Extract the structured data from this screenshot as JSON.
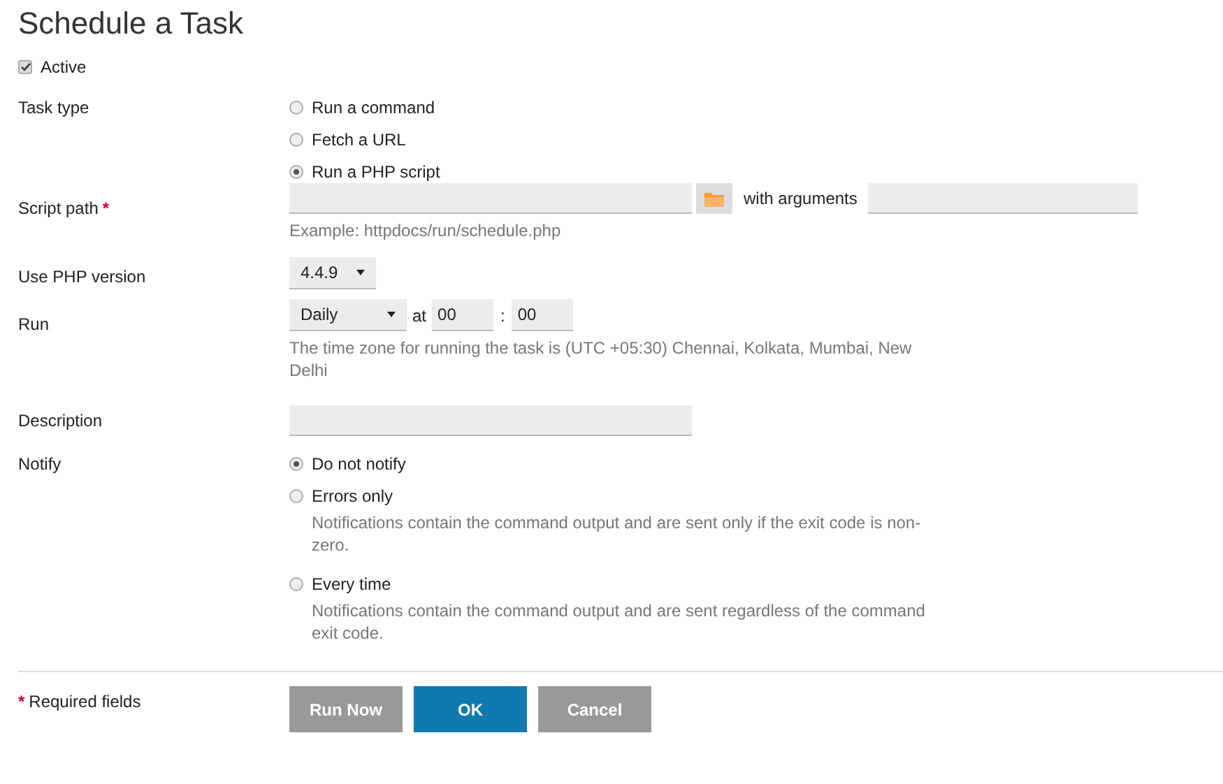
{
  "title": "Schedule a Task",
  "active": {
    "label": "Active",
    "checked": true
  },
  "task_type": {
    "label": "Task type",
    "options": [
      {
        "label": "Run a command",
        "selected": false
      },
      {
        "label": "Fetch a URL",
        "selected": false
      },
      {
        "label": "Run a PHP script",
        "selected": true
      }
    ]
  },
  "script_path": {
    "label": "Script path",
    "required_mark": "*",
    "arguments_label": "with arguments",
    "hint": "Example: httpdocs/run/schedule.php"
  },
  "php_version": {
    "label": "Use PHP version",
    "value": "4.4.9"
  },
  "run": {
    "label": "Run",
    "frequency": "Daily",
    "at_label": "at",
    "hour": "00",
    "separator": ":",
    "minute": "00",
    "hint": "The time zone for running the task is (UTC +05:30) Chennai, Kolkata, Mumbai, New Delhi"
  },
  "description": {
    "label": "Description"
  },
  "notify": {
    "label": "Notify",
    "options": [
      {
        "label": "Do not notify",
        "selected": true
      },
      {
        "label": "Errors only",
        "selected": false,
        "note": "Notifications contain the command output and are sent only if the exit code is non-zero."
      },
      {
        "label": "Every time",
        "selected": false,
        "note": "Notifications contain the command output and are sent regardless of the command exit code."
      }
    ]
  },
  "required_note": {
    "mark": "*",
    "text": "Required fields"
  },
  "buttons": [
    {
      "label": "Run Now",
      "kind": "secondary"
    },
    {
      "label": "OK",
      "kind": "primary"
    },
    {
      "label": "Cancel",
      "kind": "secondary"
    }
  ]
}
